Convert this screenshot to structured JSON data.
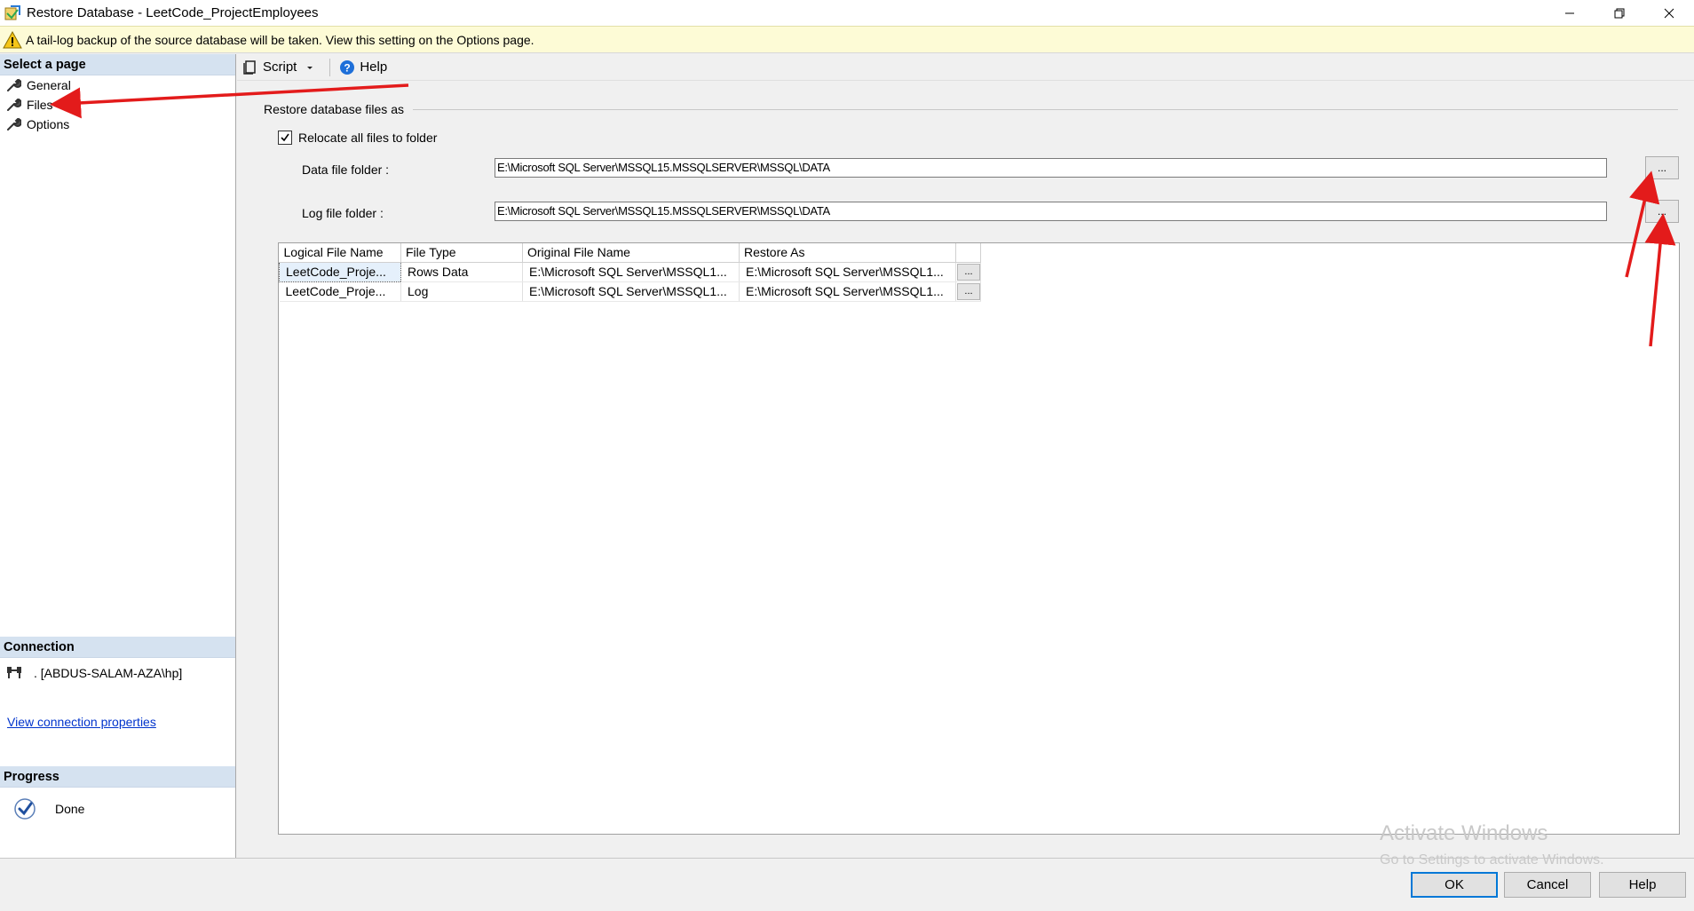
{
  "window": {
    "title": "Restore Database - LeetCode_ProjectEmployees"
  },
  "warning": {
    "text": "A tail-log backup of the source database will be taken. View this setting on the Options page."
  },
  "sidebar": {
    "header": "Select a page",
    "items": [
      {
        "label": "General"
      },
      {
        "label": "Files"
      },
      {
        "label": "Options"
      }
    ]
  },
  "connection": {
    "header": "Connection",
    "server": ". [ABDUS-SALAM-AZA\\hp]",
    "link": "View connection properties"
  },
  "progress": {
    "header": "Progress",
    "status": "Done"
  },
  "toolbar": {
    "script_label": "Script",
    "help_label": "Help"
  },
  "restore_files": {
    "group_title": "Restore database files as",
    "relocate_label": "Relocate all files to folder",
    "relocate_checked": true,
    "data_label": "Data file folder :",
    "data_value": "E:\\Microsoft SQL Server\\MSSQL15.MSSQLSERVER\\MSSQL\\DATA",
    "log_label": "Log file folder :",
    "log_value": "E:\\Microsoft SQL Server\\MSSQL15.MSSQLSERVER\\MSSQL\\DATA",
    "browse_label": "..."
  },
  "grid": {
    "columns": [
      "Logical File Name",
      "File Type",
      "Original File Name",
      "Restore As"
    ],
    "rows": [
      {
        "logical": "LeetCode_Proje...",
        "type": "Rows Data",
        "original": "E:\\Microsoft SQL Server\\MSSQL1...",
        "restore": "E:\\Microsoft SQL Server\\MSSQL1...",
        "btn": "..."
      },
      {
        "logical": "LeetCode_Proje...",
        "type": "Log",
        "original": "E:\\Microsoft SQL Server\\MSSQL1...",
        "restore": "E:\\Microsoft SQL Server\\MSSQL1...",
        "btn": "..."
      }
    ]
  },
  "watermark": {
    "line1": "Activate Windows",
    "line2": "Go to Settings to activate Windows."
  },
  "buttons": {
    "ok": "OK",
    "cancel": "Cancel",
    "help": "Help"
  },
  "colors": {
    "accent": "#0078d7",
    "section_header": "#d5e2f0",
    "warning_bg": "#fdfbd6",
    "annotation_arrow": "#e31b1b"
  }
}
